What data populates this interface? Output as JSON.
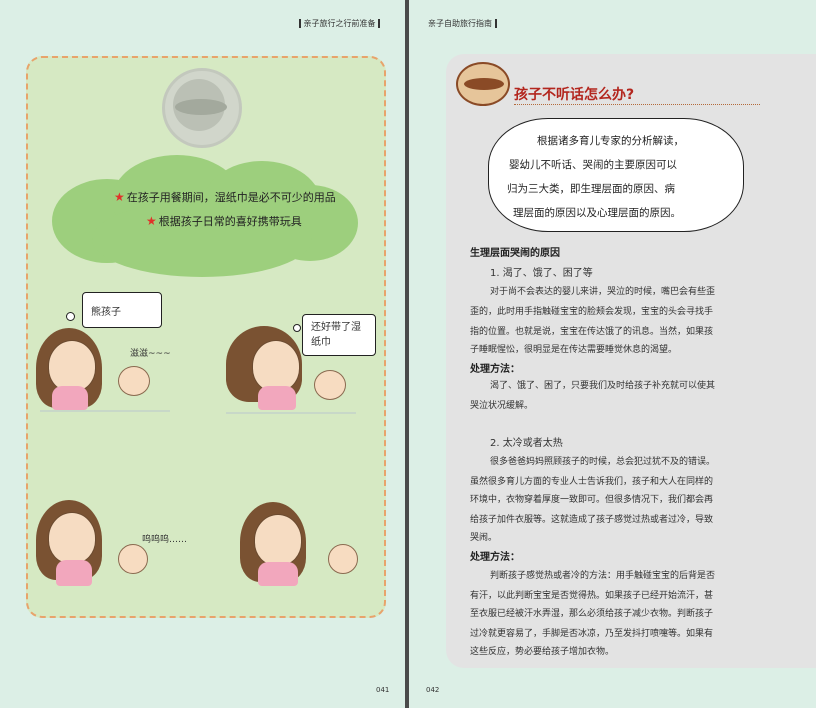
{
  "left_page": {
    "running_head": "亲子旅行之行前准备",
    "folio": "041",
    "tips": [
      "在孩子用餐期间，湿纸巾是必不可少的用品",
      "根据孩子日常的喜好携带玩具"
    ],
    "comic": {
      "bubble1": "熊孩子",
      "sound1": "滋滋~~~",
      "bubble2_line1": "还好带了湿",
      "bubble2_line2": "纸巾",
      "sound2": "呜呜呜……"
    }
  },
  "right_page": {
    "running_head": "亲子自助旅行指南",
    "folio": "042",
    "title": "孩子不听话怎么办?",
    "logo_text": "Travel Guide",
    "intro_lines": [
      "根据诸多育儿专家的分析解读，",
      "婴幼儿不听话、哭闹的主要原因可以",
      "归为三大类，即生理层面的原因、病",
      "理层面的原因以及心理层面的原因。"
    ],
    "section_heading": "生理层面哭闹的原因",
    "item1_title": "1. 渴了、饿了、困了等",
    "item1_lines": [
      "对于尚不会表达的婴儿来讲，哭泣的时候，嘴巴会有些歪",
      "歪的，此时用手指触碰宝宝的脸颊会发现，宝宝的头会寻找手",
      "指的位置。也就是说，宝宝在传达饿了的讯息。当然，如果孩",
      "子睡眠惺忪，很明显是在传达需要睡觉休息的渴望。"
    ],
    "method_label_1": "处理方法：",
    "method1_lines": [
      "渴了、饿了、困了，只要我们及时给孩子补充就可以使其",
      "哭泣状况缓解。"
    ],
    "item2_title": "2. 太冷或者太热",
    "item2_lines": [
      "很多爸爸妈妈照顾孩子的时候，总会犯过犹不及的错误。",
      "虽然很多育儿方面的专业人士告诉我们，孩子和大人在同样的",
      "环境中，衣物穿着厚度一致即可。但很多情况下，我们都会再",
      "给孩子加件衣服等。这就造成了孩子感觉过热或者过冷，导致",
      "哭闹。"
    ],
    "method_label_2": "处理方法：",
    "method2_lines": [
      "判断孩子感觉热或者冷的方法：用手触碰宝宝的后背是否",
      "有汗，以此判断宝宝是否觉得热。如果孩子已经开始流汗，甚",
      "至衣服已经被汗水弄湿，那么必须给孩子减少衣物。判断孩子",
      "过冷就更容易了，手脚是否冰凉，乃至发抖打喷嚏等。如果有",
      "这些反应，势必要给孩子增加衣物。"
    ]
  }
}
